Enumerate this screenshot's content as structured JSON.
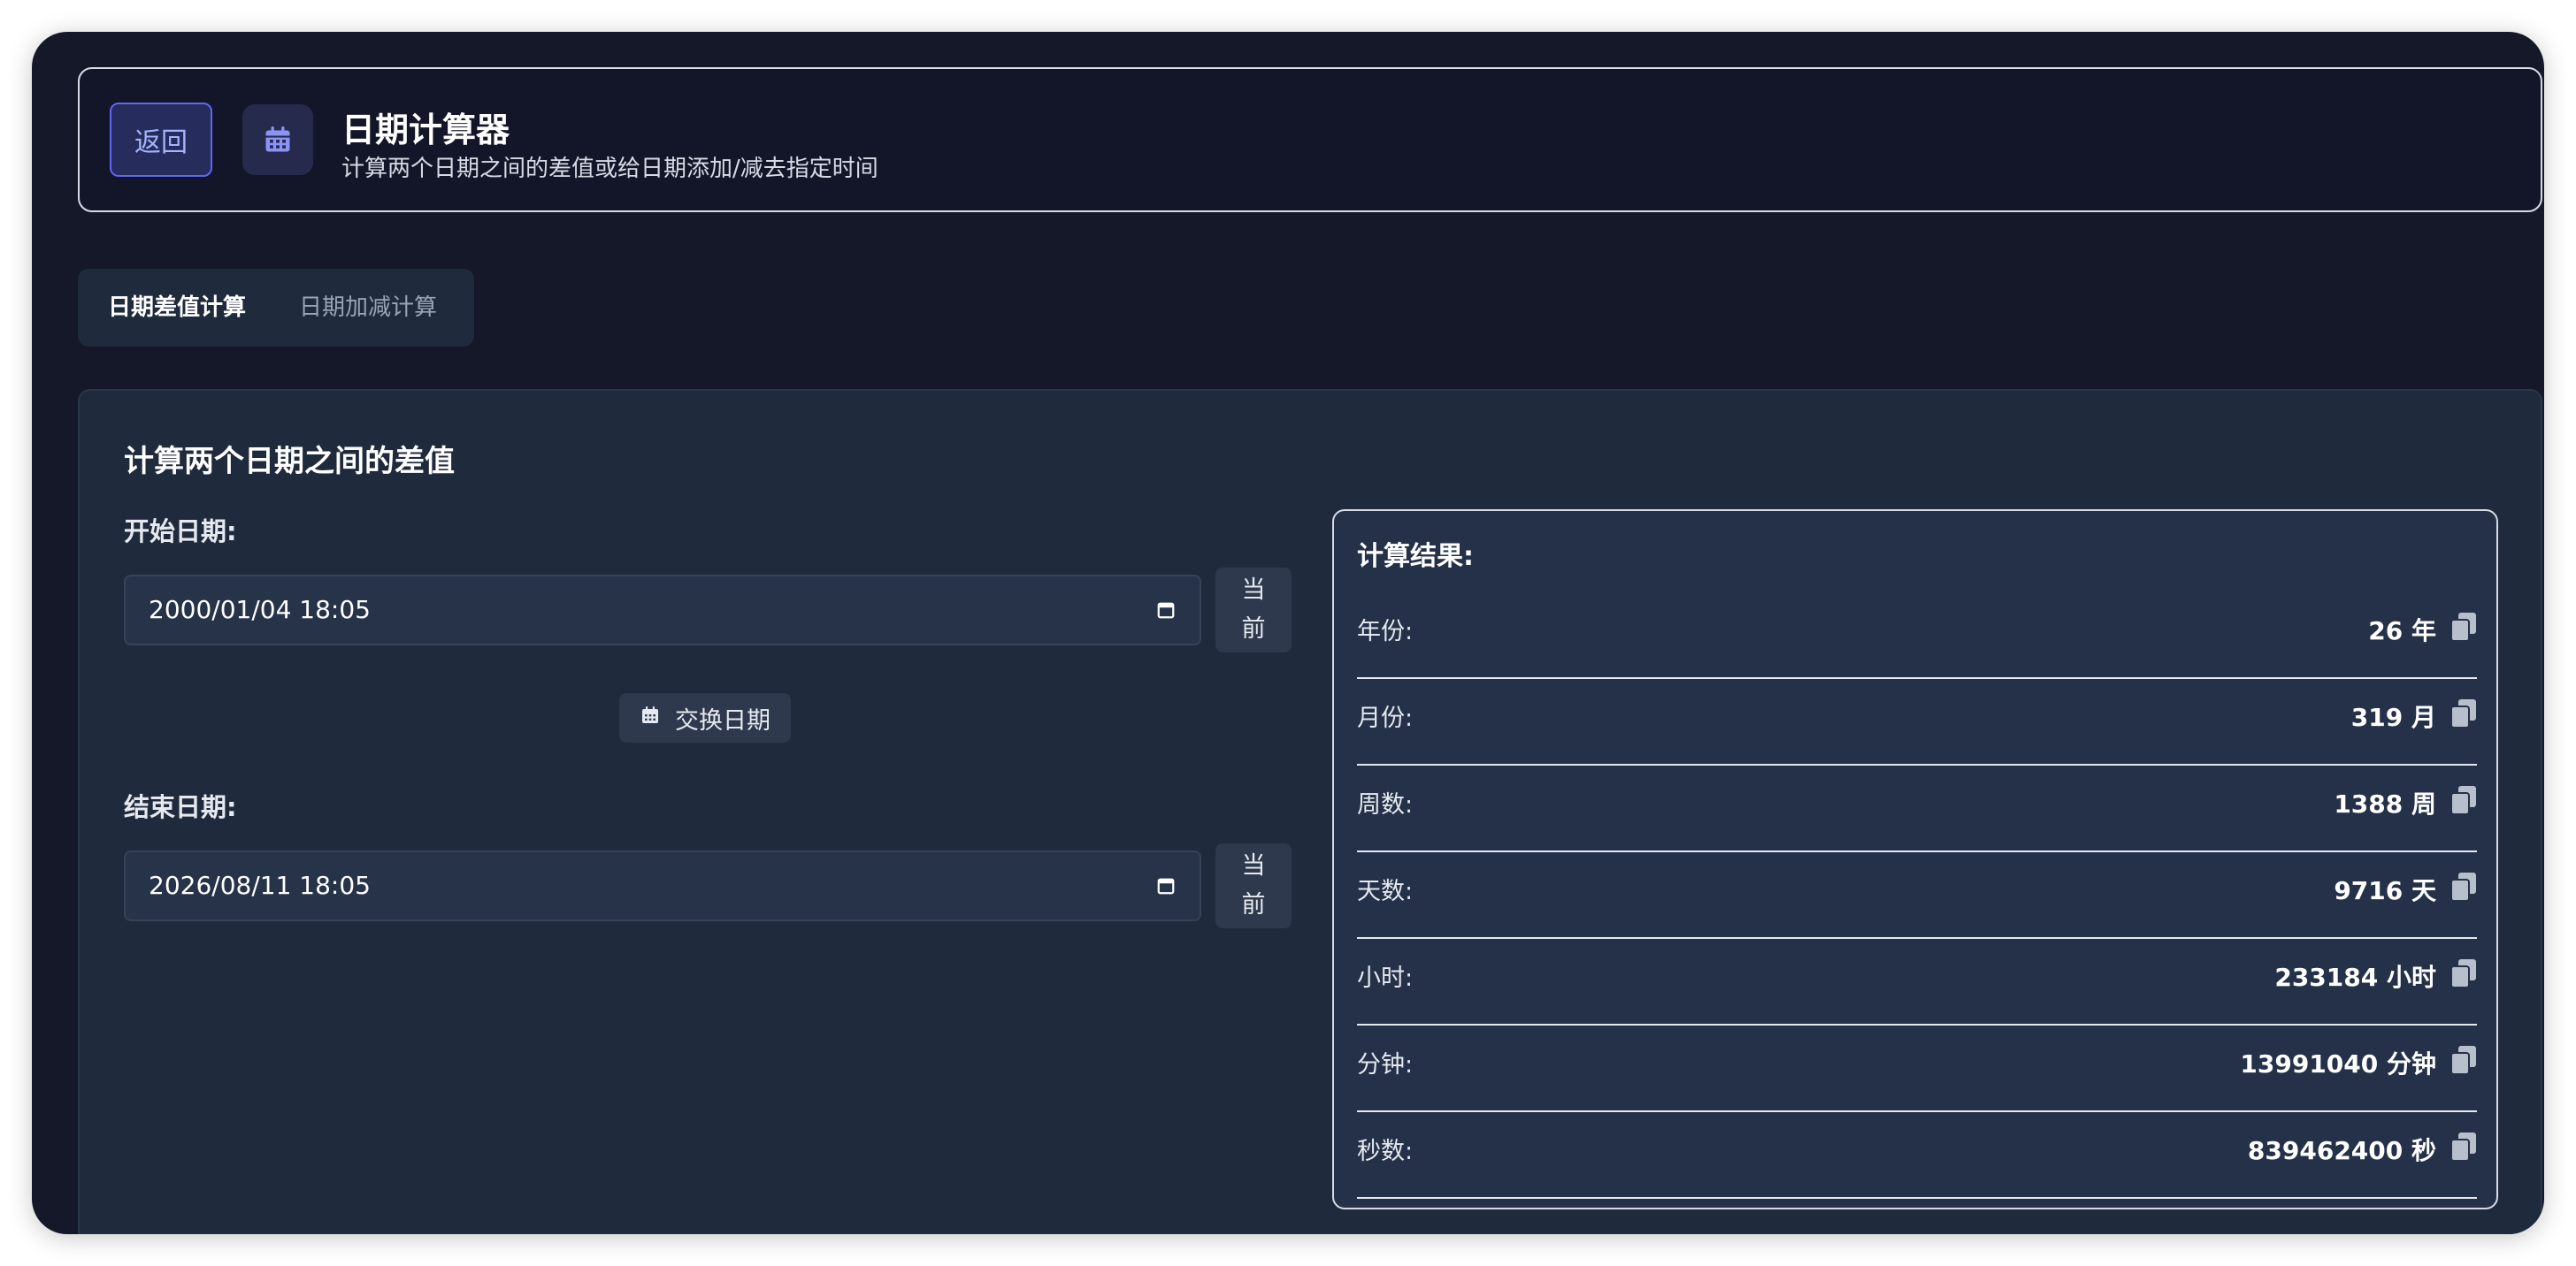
{
  "header": {
    "back_label": "返回",
    "title": "日期计算器",
    "subtitle": "计算两个日期之间的差值或给日期添加/减去指定时间",
    "icon": "calendar-icon"
  },
  "tabs": [
    {
      "label": "日期差值计算",
      "active": true
    },
    {
      "label": "日期加减计算",
      "active": false
    }
  ],
  "panel": {
    "title": "计算两个日期之间的差值",
    "start": {
      "label": "开始日期:",
      "value": "2000/01/04  18:05",
      "now_label": "当前"
    },
    "swap_label": "交换日期",
    "end": {
      "label": "结束日期:",
      "value": "2026/08/11  18:05",
      "now_label": "当前"
    }
  },
  "result": {
    "title": "计算结果:",
    "rows": [
      {
        "label": "年份:",
        "value": "26 年"
      },
      {
        "label": "月份:",
        "value": "319 月"
      },
      {
        "label": "周数:",
        "value": "1388 周"
      },
      {
        "label": "天数:",
        "value": "9716 天"
      },
      {
        "label": "小时:",
        "value": "233184 小时"
      },
      {
        "label": "分钟:",
        "value": "13991040 分钟"
      },
      {
        "label": "秒数:",
        "value": "839462400 秒"
      }
    ]
  },
  "colors": {
    "accent": "#6366f1",
    "window_bg": "#141828",
    "panel_bg": "#1f2a3c"
  }
}
